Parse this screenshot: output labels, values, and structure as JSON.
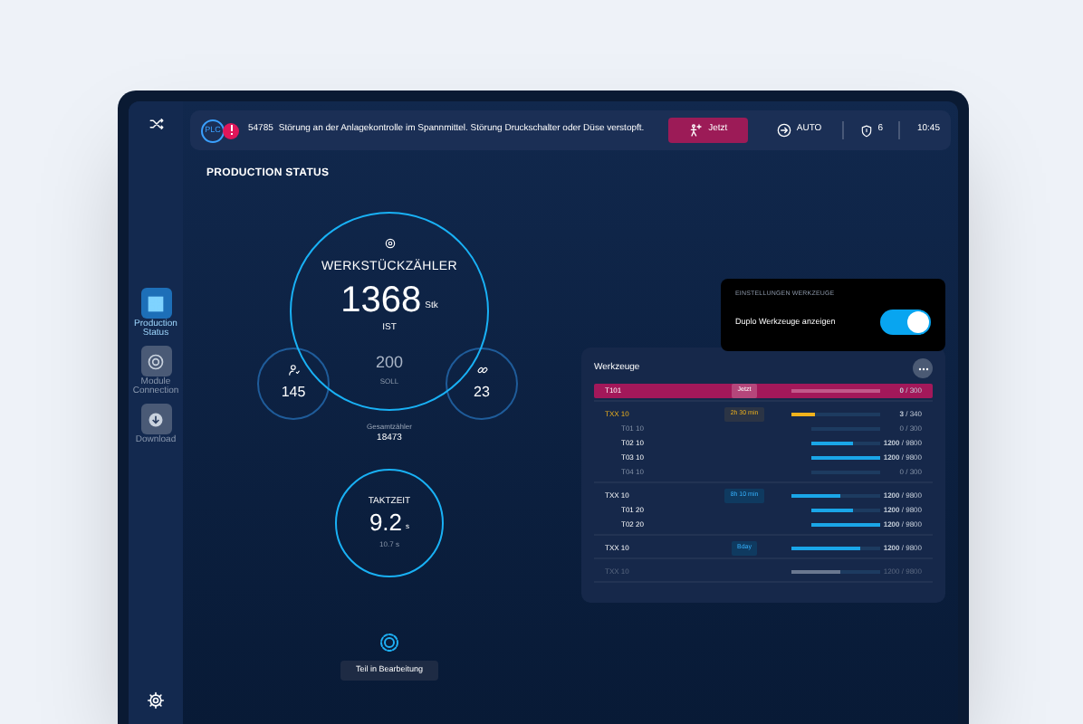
{
  "topbar": {
    "plc_label": "PLC",
    "code": "54785",
    "message": "Störung an der Anlagekontrolle im Spannmittel. Störung Druckschalter oder Düse verstopft.",
    "action_button": "Jetzt",
    "mode": "AUTO",
    "shield_count": "6",
    "time": "10:45"
  },
  "sidebar": {
    "items": [
      {
        "label": "Production Status",
        "kind": "dashboard",
        "selected": true
      },
      {
        "label": "Module Connection",
        "kind": "module",
        "selected": false
      },
      {
        "label": "Download",
        "kind": "download",
        "selected": false
      }
    ]
  },
  "page_title": "PRODUCTION STATUS",
  "counter": {
    "title": "WERKSTÜCKZÄHLER",
    "value": "1368",
    "unit": "Stk",
    "value_label": "IST",
    "target": "200",
    "target_label": "SOLL",
    "left_value": "145",
    "right_value": "23",
    "total_label": "Gesamtzähler",
    "total": "18473"
  },
  "cycle": {
    "title": "TAKTZEIT",
    "value": "9.2",
    "unit": "s",
    "target": "10.7 s"
  },
  "status_button": "Teil in Bearbeitung",
  "settings_popup": {
    "title": "EINSTELLUNGEN WERKZEUGE",
    "label": "Duplo Werkzeuge anzeigen",
    "on": true
  },
  "tools": {
    "title": "Werkzeuge",
    "groups": [
      {
        "name": "T101",
        "selected": true,
        "warning": false,
        "disabled": false,
        "badge": {
          "text": "Jetzt",
          "kind": "now"
        },
        "reading": "**0** / 300"
      },
      {
        "name": "TXX 10",
        "selected": false,
        "warning": true,
        "disabled": false,
        "badge": {
          "text": "2h 30 min",
          "kind": "warning"
        },
        "level": 0.27,
        "reading": "**3** / 340",
        "children": [
          {
            "name": "T01 10",
            "active": false,
            "level": 0,
            "reading": "0 / 300"
          },
          {
            "name": "T02 10",
            "active": true,
            "level": 0.6,
            "reading": "**1200** / 9800"
          },
          {
            "name": "T03 10",
            "active": true,
            "level": 1,
            "reading": "**1200** / 9800"
          },
          {
            "name": "T04 10",
            "active": false,
            "level": 0,
            "reading": "0 / 300"
          }
        ]
      },
      {
        "name": "TXX 10",
        "selected": false,
        "warning": false,
        "disabled": false,
        "badge": {
          "text": "8h 10 min",
          "kind": "info"
        },
        "level": 0.55,
        "reading": "**1200** / 9800",
        "children": [
          {
            "name": "T01 20",
            "active": true,
            "level": 0.6,
            "reading": "**1200** / 9800"
          },
          {
            "name": "T02 20",
            "active": true,
            "level": 1,
            "reading": "**1200** / 9800"
          }
        ]
      },
      {
        "name": "TXX 10",
        "selected": false,
        "warning": false,
        "disabled": false,
        "badge": {
          "text": "Bday",
          "kind": "info"
        },
        "level": 0.78,
        "reading": "**1200** / 9800"
      },
      {
        "name": "TXX 10",
        "selected": false,
        "warning": false,
        "disabled": true,
        "level": 0.55,
        "reading": "1200 / 9800"
      }
    ]
  }
}
